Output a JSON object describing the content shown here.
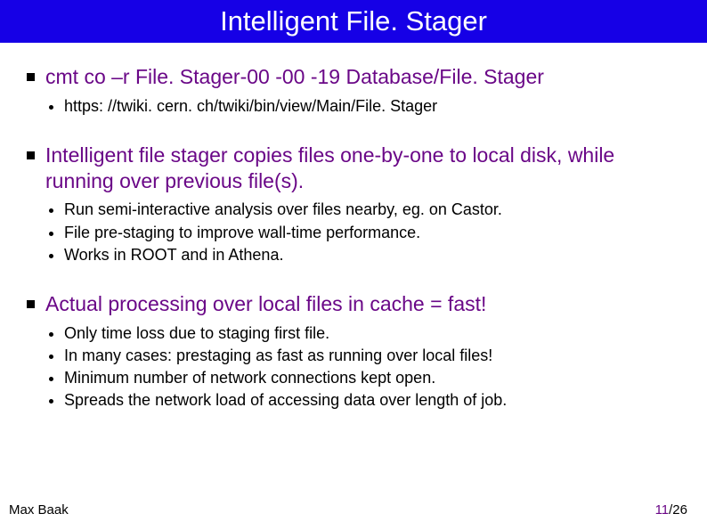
{
  "title": "Intelligent File. Stager",
  "sections": [
    {
      "heading": "cmt co –r File. Stager-00 -00 -19 Database/File. Stager",
      "items": [
        "https: //twiki. cern. ch/twiki/bin/view/Main/File. Stager"
      ]
    },
    {
      "heading": "Intelligent file stager copies files one-by-one to local disk, while running over previous file(s).",
      "items": [
        "Run semi-interactive analysis over files nearby, eg. on Castor.",
        "File pre-staging to improve wall-time performance.",
        "Works in ROOT and in Athena."
      ]
    },
    {
      "heading": "Actual processing over local files in cache = fast!",
      "items": [
        "Only time loss due to staging first file.",
        "In many cases: prestaging as fast as running over local files!",
        "Minimum number of network connections kept open.",
        "Spreads the network load of accessing data over length of job."
      ]
    }
  ],
  "footer": {
    "author": "Max Baak",
    "page_current": "11",
    "page_sep_total": "/26"
  }
}
